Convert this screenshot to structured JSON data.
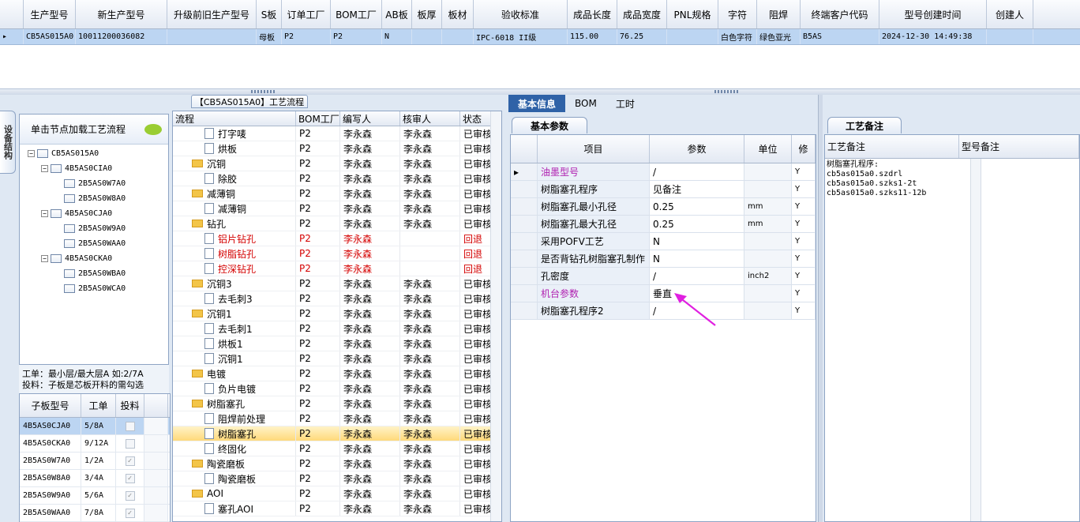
{
  "top_grid": {
    "headers": [
      "生产型号",
      "新生产型号",
      "升级前旧生产型号",
      "S板",
      "订单工厂",
      "BOM工厂",
      "AB板",
      "板厚",
      "板材",
      "验收标准",
      "成品长度",
      "成品宽度",
      "PNL规格",
      "字符",
      "阻焊",
      "终端客户代码",
      "型号创建时间",
      "创建人"
    ],
    "row": [
      "CB5AS015A0",
      "10011200036082",
      "",
      "母板",
      "P2",
      "P2",
      "N",
      "",
      "",
      "IPC-6018 II级",
      "115.00",
      "76.25",
      "",
      "白色字符",
      "绿色亚光",
      "B5AS",
      "2024-12-30 14:49:38",
      ""
    ]
  },
  "left": {
    "panel_title": "【CB5AS015A0】工艺流程",
    "vertical_tab": "设备结构",
    "tree_header": "单击节点加载工艺流程",
    "tree": [
      "CB5AS015A0",
      "4B5AS0CIA0",
      "2B5AS0W7A0",
      "2B5AS0W8A0",
      "4B5AS0CJA0",
      "2B5AS0W9A0",
      "2B5AS0WAA0",
      "4B5AS0CKA0",
      "2B5AS0WBA0",
      "2B5AS0WCA0"
    ],
    "info_line1": "工单：最小层/最大层A 如:2/7A",
    "info_line2": "投料：子板是芯板开料的需勾选",
    "sub_headers": [
      "子板型号",
      "工单",
      "投料"
    ],
    "sub_rows": [
      [
        "4B5AS0CJA0",
        "5/8A",
        ""
      ],
      [
        "4B5AS0CKA0",
        "9/12A",
        ""
      ],
      [
        "2B5AS0W7A0",
        "1/2A",
        "✓"
      ],
      [
        "2B5AS0W8A0",
        "3/4A",
        "✓"
      ],
      [
        "2B5AS0W9A0",
        "5/6A",
        "✓"
      ],
      [
        "2B5AS0WAA0",
        "7/8A",
        "✓"
      ]
    ]
  },
  "flow": {
    "headers": [
      "流程",
      "BOM工厂",
      "编写人",
      "核审人",
      "状态"
    ],
    "rows": [
      {
        "name": "打字唛",
        "f": "P2",
        "w": "李永森",
        "r": "李永森",
        "s": "已审核",
        "t": "leaf"
      },
      {
        "name": "烘板",
        "f": "P2",
        "w": "李永森",
        "r": "李永森",
        "s": "已审核",
        "t": "leaf"
      },
      {
        "name": "沉铜",
        "f": "P2",
        "w": "李永森",
        "r": "李永森",
        "s": "已审核",
        "t": "folder"
      },
      {
        "name": "除胶",
        "f": "P2",
        "w": "李永森",
        "r": "李永森",
        "s": "已审核",
        "t": "leaf"
      },
      {
        "name": "减薄铜",
        "f": "P2",
        "w": "李永森",
        "r": "李永森",
        "s": "已审核",
        "t": "folder"
      },
      {
        "name": "减薄铜",
        "f": "P2",
        "w": "李永森",
        "r": "李永森",
        "s": "已审核",
        "t": "leaf"
      },
      {
        "name": "钻孔",
        "f": "P2",
        "w": "李永森",
        "r": "李永森",
        "s": "已审核",
        "t": "folder"
      },
      {
        "name": "铝片钻孔",
        "f": "P2",
        "w": "李永森",
        "r": "",
        "s": "回退",
        "t": "leaf",
        "red": true
      },
      {
        "name": "树脂钻孔",
        "f": "P2",
        "w": "李永森",
        "r": "",
        "s": "回退",
        "t": "leaf",
        "red": true
      },
      {
        "name": "控深钻孔",
        "f": "P2",
        "w": "李永森",
        "r": "",
        "s": "回退",
        "t": "leaf",
        "red": true
      },
      {
        "name": "沉铜3",
        "f": "P2",
        "w": "李永森",
        "r": "李永森",
        "s": "已审核",
        "t": "folder"
      },
      {
        "name": "去毛刺3",
        "f": "P2",
        "w": "李永森",
        "r": "李永森",
        "s": "已审核",
        "t": "leaf"
      },
      {
        "name": "沉铜1",
        "f": "P2",
        "w": "李永森",
        "r": "李永森",
        "s": "已审核",
        "t": "folder"
      },
      {
        "name": "去毛刺1",
        "f": "P2",
        "w": "李永森",
        "r": "李永森",
        "s": "已审核",
        "t": "leaf"
      },
      {
        "name": "烘板1",
        "f": "P2",
        "w": "李永森",
        "r": "李永森",
        "s": "已审核",
        "t": "leaf"
      },
      {
        "name": "沉铜1",
        "f": "P2",
        "w": "李永森",
        "r": "李永森",
        "s": "已审核",
        "t": "leaf"
      },
      {
        "name": "电镀",
        "f": "P2",
        "w": "李永森",
        "r": "李永森",
        "s": "已审核",
        "t": "folder"
      },
      {
        "name": "负片电镀",
        "f": "P2",
        "w": "李永森",
        "r": "李永森",
        "s": "已审核",
        "t": "leaf"
      },
      {
        "name": "树脂塞孔",
        "f": "P2",
        "w": "李永森",
        "r": "李永森",
        "s": "已审核",
        "t": "folder"
      },
      {
        "name": "阻焊前处理",
        "f": "P2",
        "w": "李永森",
        "r": "李永森",
        "s": "已审核",
        "t": "leaf"
      },
      {
        "name": "树脂塞孔",
        "f": "P2",
        "w": "李永森",
        "r": "李永森",
        "s": "已审核",
        "t": "leaf",
        "sel": true
      },
      {
        "name": "终固化",
        "f": "P2",
        "w": "李永森",
        "r": "李永森",
        "s": "已审核",
        "t": "leaf"
      },
      {
        "name": "陶瓷磨板",
        "f": "P2",
        "w": "李永森",
        "r": "李永森",
        "s": "已审核",
        "t": "folder"
      },
      {
        "name": "陶瓷磨板",
        "f": "P2",
        "w": "李永森",
        "r": "李永森",
        "s": "已审核",
        "t": "leaf"
      },
      {
        "name": "AOI",
        "f": "P2",
        "w": "李永森",
        "r": "李永森",
        "s": "已审核",
        "t": "folder"
      },
      {
        "name": "塞孔AOI",
        "f": "P2",
        "w": "李永森",
        "r": "李永森",
        "s": "已审核",
        "t": "leaf"
      }
    ]
  },
  "right": {
    "tabs": [
      "基本信息",
      "BOM",
      "工时"
    ],
    "inner_tab": "基本参数",
    "param_headers": [
      "项目",
      "参数",
      "单位",
      "修"
    ],
    "params": [
      {
        "item": "油墨型号",
        "value": "/",
        "unit": "",
        "flag": "Y",
        "mag": true
      },
      {
        "item": "树脂塞孔程序",
        "value": "见备注",
        "unit": "",
        "flag": "Y"
      },
      {
        "item": "树脂塞孔最小孔径",
        "value": "0.25",
        "unit": "mm",
        "flag": "Y"
      },
      {
        "item": "树脂塞孔最大孔径",
        "value": "0.25",
        "unit": "mm",
        "flag": "Y"
      },
      {
        "item": "采用POFV工艺",
        "value": "N",
        "unit": "",
        "flag": "Y"
      },
      {
        "item": "是否背钻孔树脂塞孔制作",
        "value": "N",
        "unit": "",
        "flag": "Y"
      },
      {
        "item": "孔密度",
        "value": "/",
        "unit": "inch2",
        "flag": "Y"
      },
      {
        "item": "机台参数",
        "value": "垂直",
        "unit": "",
        "flag": "Y",
        "mag": true
      },
      {
        "item": "树脂塞孔程序2",
        "value": "/",
        "unit": "",
        "flag": "Y"
      }
    ],
    "note_tab": "工艺备注",
    "note_headers": [
      "工艺备注",
      "型号备注"
    ],
    "note_text": "树脂塞孔程序:\ncb5as015a0.szdrl\ncb5as015a0.szks1-2t\ncb5as015a0.szks11-12b"
  },
  "colors": {
    "accent": "#2f62a7",
    "selection": "#bcd5f2",
    "arrow": "#e020e0"
  }
}
